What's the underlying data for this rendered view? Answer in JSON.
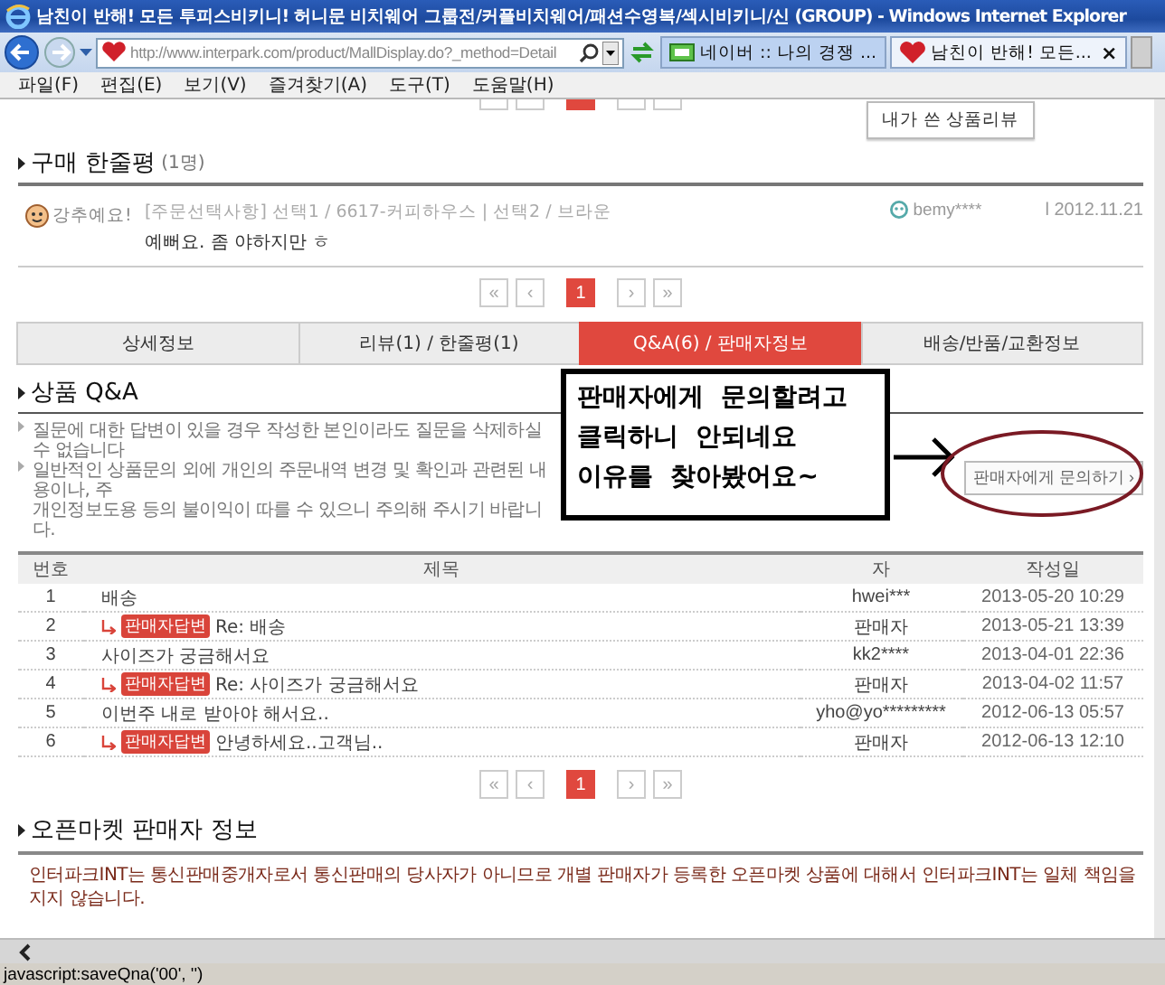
{
  "window": {
    "title": "남친이 반해! 모든 투피스비키니! 허니문 비치웨어 그룹전/커플비치웨어/패션수영복/섹시비키니/신 (GROUP) - Windows Internet Explorer"
  },
  "address_bar": {
    "value": "http://www.interpark.com/product/MallDisplay.do?_method=Detail"
  },
  "browser_tabs": [
    {
      "kind": "naver",
      "label": "네이버 :: 나의 경쟁 ...",
      "selected": false
    },
    {
      "kind": "heart",
      "label": "남친이 반해! 모든...",
      "selected": true,
      "close": "×"
    }
  ],
  "menu": [
    "파일(F)",
    "편집(E)",
    "보기(V)",
    "즐겨찾기(A)",
    "도구(T)",
    "도움말(H)"
  ],
  "my_review_button": "내가 쓴 상품리뷰",
  "review_section": {
    "title": "구매 한줄평",
    "count": "(1명)",
    "reviews": [
      {
        "badge": "강추예요!",
        "option": "[주문선택사항] 선택1 / 6617-커피하우스 | 선택2 / 브라운",
        "text": "예뻐요. 좀 야하지만 ㅎ",
        "user": "bemy****",
        "date": "l 2012.11.21"
      }
    ]
  },
  "review_pager": {
    "first": "«",
    "prev": "‹",
    "pages": [
      {
        "label": "1",
        "selected": true
      }
    ],
    "next": "›",
    "last": "»"
  },
  "product_tabs": [
    {
      "label": "상세정보",
      "selected": false
    },
    {
      "label": "리뷰(1) / 한줄평(1)",
      "selected": false
    },
    {
      "label": "Q&A(6) / 판매자정보",
      "selected": true
    },
    {
      "label": "배송/반품/교환정보",
      "selected": false
    }
  ],
  "qna": {
    "title": "상품 Q&A",
    "notes": [
      {
        "kind": "bullet",
        "text": "질문에 대한 답변이 있을 경우 작성한 본인이라도 질문을 삭제하실 수 없습니다"
      },
      {
        "kind": "bullet",
        "text": "일반적인 상품문의 외에 개인의 주문내역 변경 및 확인과 관련된 내용이나, 주"
      },
      {
        "kind": "continuation",
        "text": "개인정보도용 등의 불이익이 따를 수 있으니 주의해 주시기 바랍니다."
      }
    ],
    "ask_button": "판매자에게 문의하기 ›",
    "columns": [
      "번호",
      "제목",
      "자",
      "작성일"
    ],
    "rows": [
      {
        "no": "1",
        "kind": "question",
        "title": "배송",
        "author": "hwei***",
        "date": "2013-05-20 10:29"
      },
      {
        "no": "2",
        "kind": "answer",
        "badge": "판매자답변",
        "title": "Re: 배송",
        "author": "판매자",
        "date": "2013-05-21 13:39"
      },
      {
        "no": "3",
        "kind": "question",
        "title": "사이즈가 궁금해서요",
        "author": "kk2****",
        "date": "2013-04-01 22:36"
      },
      {
        "no": "4",
        "kind": "answer",
        "badge": "판매자답변",
        "title": "Re: 사이즈가 궁금해서요",
        "author": "판매자",
        "date": "2013-04-02 11:57"
      },
      {
        "no": "5",
        "kind": "question",
        "title": "이번주 내로 받아야 해서요..",
        "author": "yho@yo*********",
        "date": "2012-06-13 05:57"
      },
      {
        "no": "6",
        "kind": "answer",
        "badge": "판매자답변",
        "title": "안녕하세요..고객님..",
        "author": "판매자",
        "date": "2012-06-13 12:10"
      }
    ]
  },
  "qna_pager": {
    "first": "«",
    "prev": "‹",
    "pages": [
      {
        "label": "1",
        "selected": true
      }
    ],
    "next": "›",
    "last": "»"
  },
  "seller_info": {
    "title": "오픈마켓 판매자 정보",
    "text": "인터파크INT는 통신판매중개자로서 통신판매의 당사자가 아니므로 개별 판매자가 등록한 오픈마켓 상품에 대해서 인터파크INT는 일체 책임을 지지 않습니다."
  },
  "annotation": {
    "lines": [
      "판매자에게  문의할려고",
      "클릭하니  안되네요",
      "이유를  찾아봤어요~"
    ]
  },
  "status_bar": {
    "text": "javascript:saveQna('00', '')"
  }
}
